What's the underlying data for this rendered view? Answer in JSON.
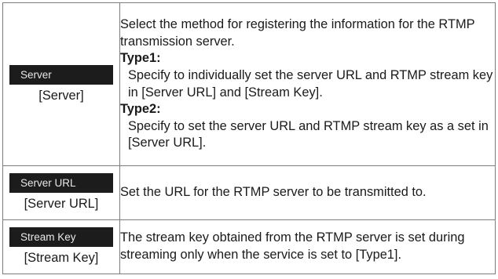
{
  "rows": [
    {
      "ui_label": "Server",
      "bracket_label": "[Server]",
      "intro": "Select the method for registering the information for the RTMP transmission server.",
      "options": [
        {
          "heading": "Type1:",
          "text": "Specify to individually set the server URL and RTMP stream key in [Server URL] and [Stream Key]."
        },
        {
          "heading": "Type2:",
          "text": "Specify to set the server URL and RTMP stream key as a set in [Server URL]."
        }
      ]
    },
    {
      "ui_label": "Server URL",
      "bracket_label": "[Server URL]",
      "description": "Set the URL for the RTMP server to be transmitted to."
    },
    {
      "ui_label": "Stream Key",
      "bracket_label": "[Stream Key]",
      "description": "The stream key obtained from the RTMP server is set during streaming only when the service is set to [Type1]."
    }
  ]
}
